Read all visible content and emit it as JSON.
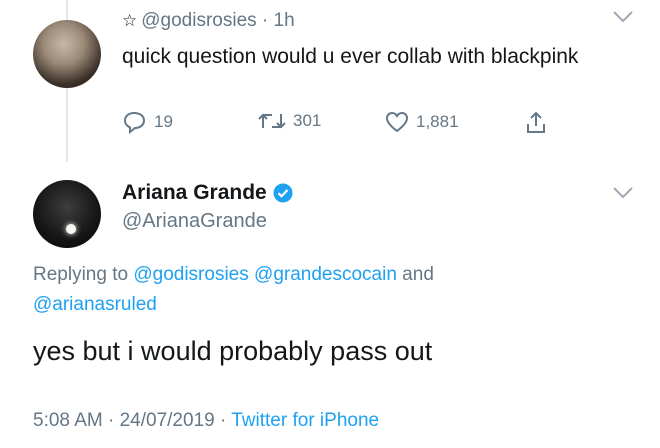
{
  "tweet1": {
    "star": "☆",
    "handle": "@godisrosies",
    "sep": " · ",
    "time": "1h",
    "text": "quick question would u ever collab with blackpink",
    "replies": "19",
    "retweets": "301",
    "likes": "1,881"
  },
  "tweet2": {
    "name": "Ariana Grande",
    "handle": "@ArianaGrande",
    "replying_prefix": "Replying to ",
    "mention1": "@godisrosies",
    "mention2": "@grandescocain",
    "and_word": " and",
    "mention3": "@arianasruled",
    "text": "yes but i would probably pass out",
    "time": "5:08 AM",
    "sep1": " · ",
    "date": "24/07/2019",
    "sep2": " · ",
    "source": "Twitter for iPhone"
  },
  "colors": {
    "link": "#1da1f2",
    "muted": "#657786",
    "text": "#14171a",
    "verified": "#1da1f2"
  },
  "icons": [
    "chevron-down-icon",
    "reply-icon",
    "retweet-icon",
    "like-icon",
    "share-icon",
    "verified-badge-icon"
  ]
}
